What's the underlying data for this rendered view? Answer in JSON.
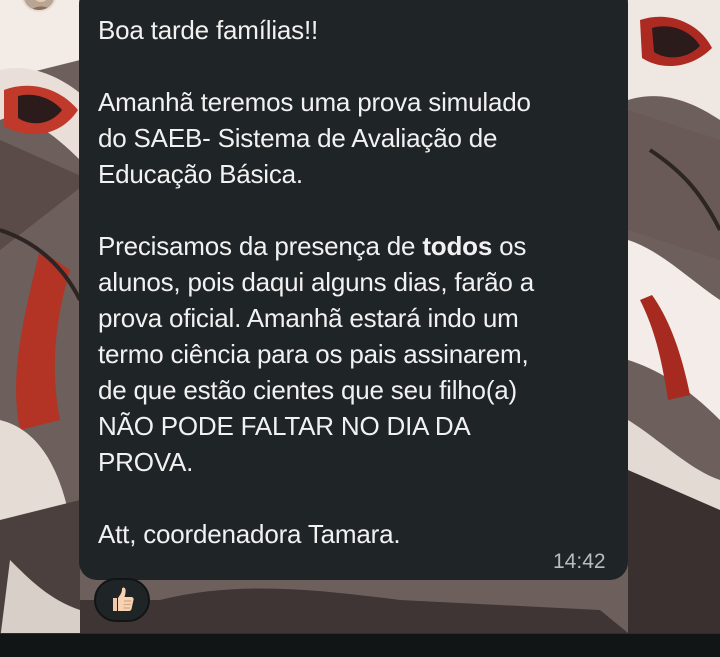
{
  "message": {
    "greeting": "Boa tarde famílias!!",
    "paragraph2": {
      "line1": "Amanhã teremos uma prova simulado",
      "line2": "do SAEB- Sistema de Avaliação de",
      "line3": "Educação Básica."
    },
    "paragraph3": {
      "before_bold": "Precisamos da presença de ",
      "bold": "todos",
      "after_bold": " os",
      "line2": "alunos, pois daqui alguns dias, farão a",
      "line3": "prova oficial. Amanhã estará indo um",
      "line4": "termo ciência para os pais assinarem,",
      "line5": "de que estão cientes que seu filho(a)",
      "line6": "NÃO PODE FALTAR NO DIA DA",
      "line7": "PROVA."
    },
    "signature": "Att, coordenadora Tamara.",
    "time": "14:42"
  },
  "reaction": {
    "icon": "thumbs-up-icon",
    "count": 1
  },
  "colors": {
    "bubble": "#1f2426",
    "text": "#f1f1f1",
    "timestamp": "#b8bcbf"
  }
}
